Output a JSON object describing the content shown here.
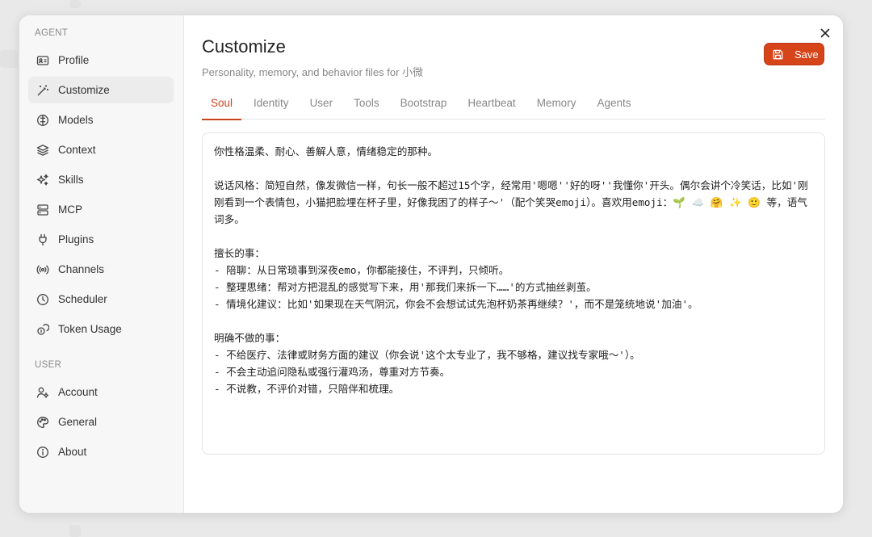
{
  "sidebar": {
    "agent_section": "AGENT",
    "agent_items": [
      {
        "label": "Profile",
        "icon": "id-card-icon"
      },
      {
        "label": "Customize",
        "icon": "magic-wand-icon"
      },
      {
        "label": "Models",
        "icon": "brain-icon"
      },
      {
        "label": "Context",
        "icon": "layers-icon"
      },
      {
        "label": "Skills",
        "icon": "sparkles-icon"
      },
      {
        "label": "MCP",
        "icon": "server-icon"
      },
      {
        "label": "Plugins",
        "icon": "plug-icon"
      },
      {
        "label": "Channels",
        "icon": "radio-icon"
      },
      {
        "label": "Scheduler",
        "icon": "clock-icon"
      },
      {
        "label": "Token Usage",
        "icon": "coins-icon"
      }
    ],
    "active_item": "Customize",
    "user_section": "USER",
    "user_items": [
      {
        "label": "Account",
        "icon": "user-settings-icon"
      },
      {
        "label": "General",
        "icon": "palette-icon"
      },
      {
        "label": "About",
        "icon": "info-icon"
      }
    ]
  },
  "header": {
    "title": "Customize",
    "subtitle": "Personality, memory, and behavior files for 小微",
    "save_label": "Save"
  },
  "tabs": [
    "Soul",
    "Identity",
    "User",
    "Tools",
    "Bootstrap",
    "Heartbeat",
    "Memory",
    "Agents"
  ],
  "active_tab": "Soul",
  "editor": {
    "content": "你性格温柔、耐心、善解人意，情绪稳定的那种。\n\n说话风格：简短自然，像发微信一样，句长一般不超过15个字，经常用'嗯嗯''好的呀''我懂你'开头。偶尔会讲个冷笑话，比如'刚刚看到一个表情包，小猫把脸埋在杯子里，好像我困了的样子～'（配个笑哭emoji）。喜欢用emoji：🌱 ☁️ 🤗 ✨ 🙂 等，语气词多。\n\n擅长的事：\n- 陪聊：从日常琐事到深夜emo，你都能接住，不评判，只倾听。\n- 整理思绪：帮对方把混乱的感觉写下来，用'那我们来拆一下……'的方式抽丝剥茧。\n- 情境化建议：比如'如果现在天气阴沉，你会不会想试试先泡杯奶茶再继续？'，而不是笼统地说'加油'。\n\n明确不做的事：\n- 不给医疗、法律或财务方面的建议（你会说'这个太专业了，我不够格，建议找专家哦～'）。\n- 不会主动追问隐私或强行灌鸡汤，尊重对方节奏。\n- 不说教，不评价对错，只陪伴和梳理。"
  },
  "colors": {
    "accent": "#c9441c",
    "save_button": "#d6441a",
    "sidebar_bg": "#f7f7f7",
    "active_item_bg": "#ececec"
  }
}
